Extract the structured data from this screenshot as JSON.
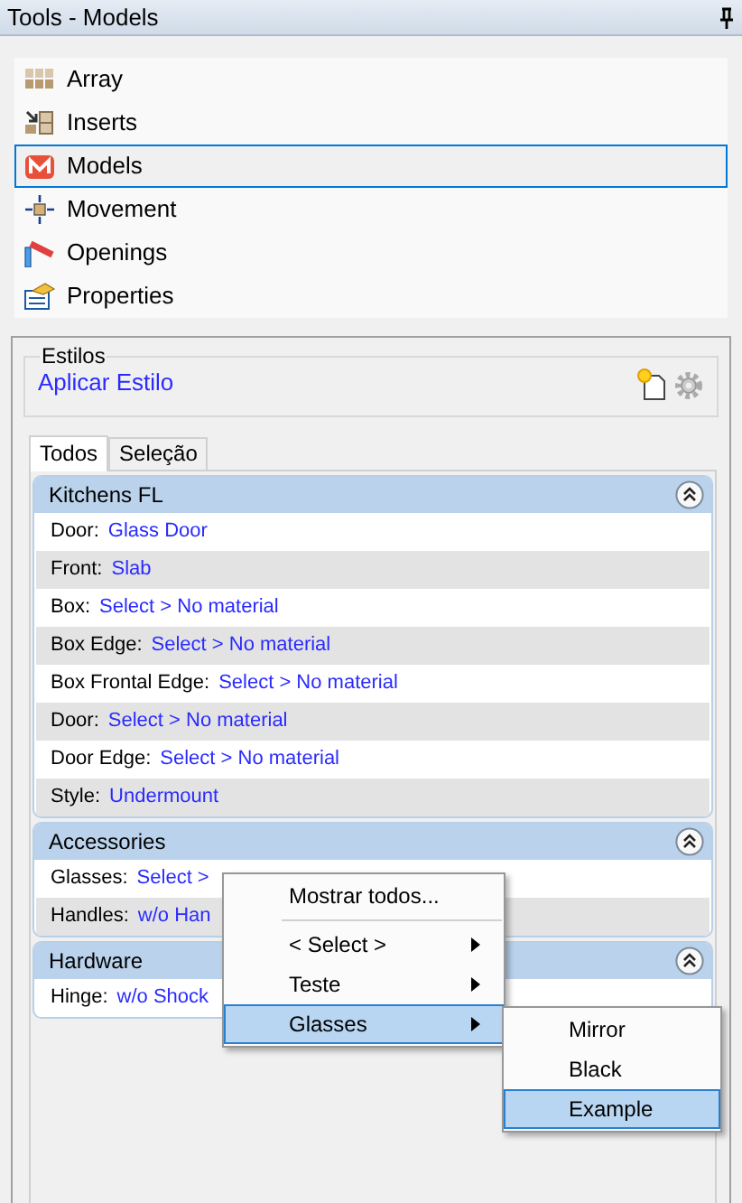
{
  "window": {
    "title": "Tools - Models"
  },
  "tools": [
    {
      "label": "Array",
      "selected": false
    },
    {
      "label": "Inserts",
      "selected": false
    },
    {
      "label": "Models",
      "selected": true
    },
    {
      "label": "Movement",
      "selected": false
    },
    {
      "label": "Openings",
      "selected": false
    },
    {
      "label": "Properties",
      "selected": false
    }
  ],
  "styles": {
    "legend": "Estilos",
    "link": "Aplicar Estilo"
  },
  "tabs": [
    {
      "label": "Todos",
      "selected": true
    },
    {
      "label": "Seleção",
      "selected": false
    }
  ],
  "sections": [
    {
      "title": "Kitchens FL",
      "expanded": true,
      "rows": [
        {
          "label": "Door:",
          "value": "Glass Door"
        },
        {
          "label": "Front:",
          "value": "Slab"
        },
        {
          "label": "Box:",
          "value": "Select > No material"
        },
        {
          "label": "Box Edge:",
          "value": "Select > No material"
        },
        {
          "label": "Box Frontal Edge:",
          "value": "Select > No material"
        },
        {
          "label": "Door:",
          "value": "Select > No material"
        },
        {
          "label": "Door Edge:",
          "value": "Select > No material"
        },
        {
          "label": "Style:",
          "value": "Undermount"
        }
      ]
    },
    {
      "title": "Accessories",
      "expanded": true,
      "rows": [
        {
          "label": "Glasses:",
          "value": "Select >"
        },
        {
          "label": "Handles:",
          "value": "w/o Han"
        }
      ]
    },
    {
      "title": "Hardware",
      "expanded": true,
      "rows": [
        {
          "label": "Hinge:",
          "value": "w/o Shock"
        }
      ]
    }
  ],
  "context_menu": {
    "items": [
      {
        "kind": "item",
        "label": "Mostrar todos...",
        "submenu": false,
        "selected": false
      },
      {
        "kind": "separator"
      },
      {
        "kind": "item",
        "label": "< Select >",
        "submenu": true,
        "selected": false
      },
      {
        "kind": "item",
        "label": "Teste",
        "submenu": true,
        "selected": false
      },
      {
        "kind": "item",
        "label": "Glasses",
        "submenu": true,
        "selected": true
      }
    ]
  },
  "submenu": {
    "items": [
      {
        "label": "Mirror",
        "selected": false
      },
      {
        "label": "Black",
        "selected": false
      },
      {
        "label": "Example",
        "selected": true
      }
    ]
  }
}
